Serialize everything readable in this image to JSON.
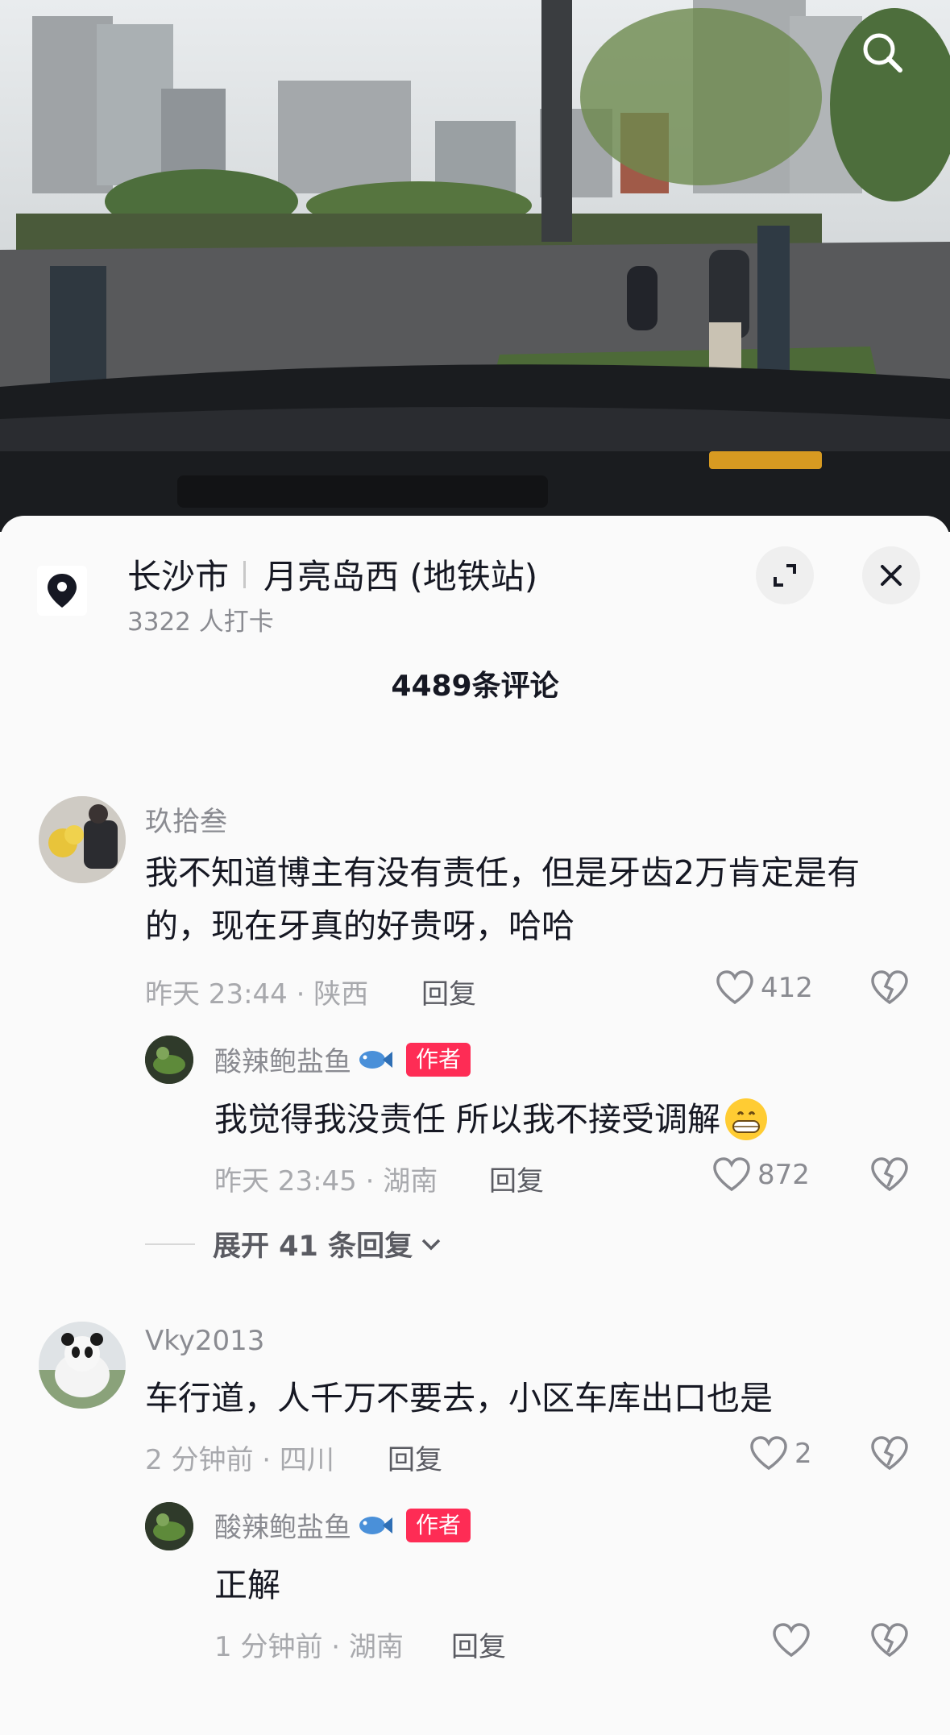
{
  "location": {
    "city": "长沙市",
    "place": "月亮岛西 (地铁站)",
    "checkins": "3322 人打卡"
  },
  "comments_count": "4489条评论",
  "icons": {
    "search": "search-icon",
    "pin": "map-pin-icon",
    "expand": "expand-icon",
    "close": "close-icon",
    "like": "heart-icon",
    "dislike": "broken-heart-icon",
    "fish": "fish-emoji",
    "grin": "grin-emoji"
  },
  "colors": {
    "accent": "#fe2c55"
  },
  "comments": [
    {
      "user": "玖拾叁",
      "text": "我不知道博主有没有责任，但是牙齿2万肯定是有的，现在牙真的好贵呀，哈哈",
      "time": "昨天 23:44 · 陕西",
      "reply": "回复",
      "likes": "412",
      "replies": [
        {
          "user": "酸辣鲍盐鱼",
          "badge": "作者",
          "text": "我觉得我没责任 所以我不接受调解",
          "time": "昨天 23:45 · 湖南",
          "reply": "回复",
          "likes": "872"
        }
      ],
      "expand": "展开 41 条回复"
    },
    {
      "user": "Vky2013",
      "text": "车行道，人千万不要去，小区车库出口也是",
      "time": "2 分钟前 · 四川",
      "reply": "回复",
      "likes": "2",
      "replies": [
        {
          "user": "酸辣鲍盐鱼",
          "badge": "作者",
          "text": "正解",
          "time": "1 分钟前 · 湖南",
          "reply": "回复",
          "likes": ""
        }
      ]
    }
  ]
}
